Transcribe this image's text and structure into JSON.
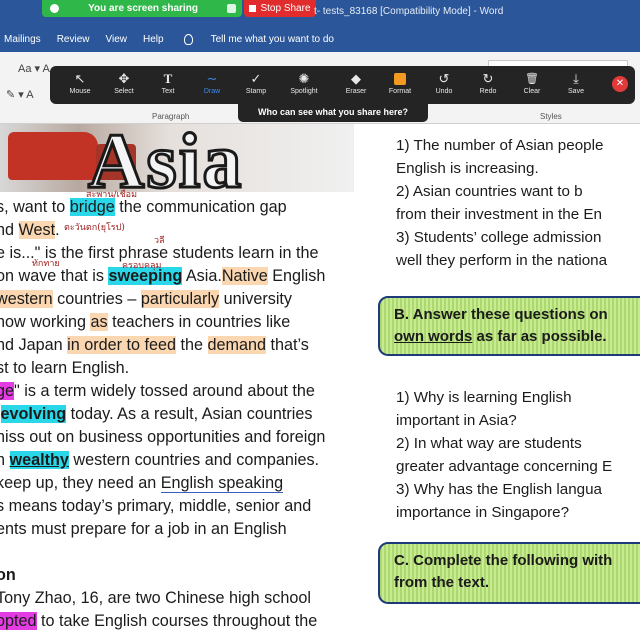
{
  "zoom": {
    "sharing_text": "You are screen sharing",
    "stop_label": "Stop Share",
    "toolbar": [
      {
        "label": "Mouse",
        "glyph": "↖",
        "icon": "mouse-icon"
      },
      {
        "label": "Select",
        "glyph": "✥",
        "icon": "select-icon"
      },
      {
        "label": "Text",
        "glyph": "T",
        "icon": "text-icon"
      },
      {
        "label": "Draw",
        "glyph": "∼",
        "icon": "draw-icon",
        "active": true
      },
      {
        "label": "Stamp",
        "glyph": "✓",
        "icon": "stamp-icon"
      },
      {
        "label": "Spotlight",
        "glyph": "✺",
        "icon": "spotlight-icon"
      },
      {
        "label": "Eraser",
        "glyph": "◆",
        "icon": "eraser-icon"
      },
      {
        "label": "Format",
        "glyph": "",
        "icon": "format-icon"
      },
      {
        "label": "Undo",
        "glyph": "↺",
        "icon": "undo-icon"
      },
      {
        "label": "Redo",
        "glyph": "↻",
        "icon": "redo-icon"
      },
      {
        "label": "Clear",
        "glyph": "🗑",
        "icon": "clear-icon"
      },
      {
        "label": "Save",
        "glyph": "⤓",
        "icon": "save-icon"
      }
    ],
    "who_can_see": "Who can see what you share here?",
    "accent": "#3d8cf2"
  },
  "word": {
    "title": "t- tests_83168 [Compatibility Mode]  -  Word",
    "tabs": [
      "Mailings",
      "Review",
      "View",
      "Help"
    ],
    "tell_me": "Tell me what you want to do",
    "font_row1": "Aa ▾  A",
    "font_row2": "✎ ▾  A",
    "paragraph_label": "Paragraph",
    "styles_label": "Styles",
    "accent": "#2b579a"
  },
  "article": {
    "heading": "Asia",
    "lines": [
      {
        "parts": [
          "s, want to ",
          "bridge",
          " the communication gap"
        ]
      },
      {
        "parts": [
          "nd ",
          "West",
          "."
        ]
      },
      {
        "parts": [
          "e is...\" is the first phrase students learn in the"
        ]
      },
      {
        "parts": [
          "on wave that is ",
          "sweeping",
          " Asia.",
          "Native",
          " English"
        ]
      },
      {
        "parts": [
          "western",
          " countries – ",
          "particularly",
          " university"
        ]
      },
      {
        "parts": [
          " now working ",
          "as",
          " teachers in countries like"
        ]
      },
      {
        "parts": [
          "nd Japan ",
          "in order to feed",
          " the ",
          "demand",
          " that’s"
        ]
      },
      {
        "parts": [
          "st to learn English."
        ]
      },
      {
        "parts": [
          "ge",
          "\" is a term widely tossed around about the"
        ]
      },
      {
        "parts": [
          "evolving",
          " today. As a result, Asian countries"
        ]
      },
      {
        "parts": [
          "niss out on business opportunities and foreign"
        ]
      },
      {
        "parts": [
          "n ",
          "wealthy",
          " western countries and companies."
        ]
      },
      {
        "parts": [
          "keep up, they need an ",
          "English speaking"
        ]
      },
      {
        "parts": [
          "s means today’s primary, middle, senior and"
        ]
      },
      {
        "parts": [
          "ents must prepare for a job in an English"
        ]
      },
      {
        "parts": [
          ""
        ]
      },
      {
        "parts": [
          "on"
        ]
      },
      {
        "parts": [
          " Tony Zhao, 16, are two Chinese high school"
        ]
      },
      {
        "parts": [
          "opted",
          " to take English courses throughout the"
        ]
      }
    ],
    "notes": [
      "สะพาน/เชื่อม",
      "ตะวันตก(ยุโรป)",
      "วลี",
      "ทักทาย",
      "ครอบคลุม"
    ]
  },
  "questions": {
    "a_items": [
      [
        "1) The number of Asian people",
        "English is increasing."
      ],
      [
        "2) Asian countries want to b",
        "from their investment in the En"
      ],
      [
        "3) Students’ college admission",
        "well they perform in the nationa"
      ]
    ],
    "b_box": [
      "B. Answer these questions on",
      "own words",
      " as far as possible."
    ],
    "b_items": [
      [
        "1)  Why  is  learning  English",
        "important in Asia?"
      ],
      [
        "2) In  what  way  are  students",
        "greater advantage concerning E"
      ],
      [
        "3) Why has the English langua",
        "importance in Singapore?"
      ]
    ],
    "c_box": [
      "C. Complete the following with",
      "from the text."
    ],
    "box_color": "#c7eb8e",
    "box_border": "#1f3a7a"
  }
}
